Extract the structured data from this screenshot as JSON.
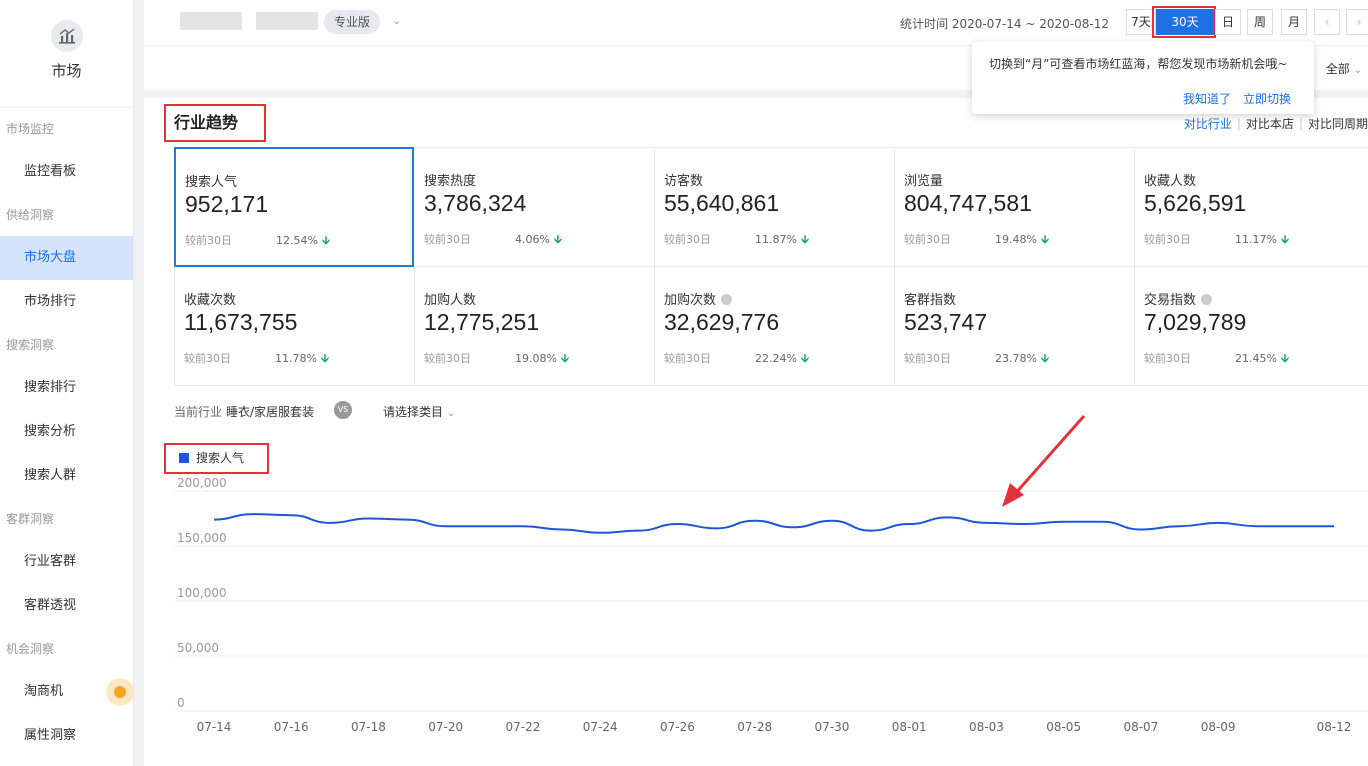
{
  "sidebar": {
    "logo_label": "市场",
    "groups": [
      {
        "label": "市场监控",
        "items": [
          "监控看板"
        ]
      },
      {
        "label": "供给洞察",
        "items": [
          "市场大盘",
          "市场排行"
        ]
      },
      {
        "label": "搜索洞察",
        "items": [
          "搜索排行",
          "搜索分析",
          "搜索人群"
        ]
      },
      {
        "label": "客群洞察",
        "items": [
          "行业客群",
          "客群透视"
        ]
      },
      {
        "label": "机会洞察",
        "items": [
          "淘商机",
          "属性洞察"
        ]
      }
    ],
    "active_item": "市场大盘"
  },
  "topbar": {
    "edition_badge": "专业版",
    "stat_time": "统计时间 2020-07-14 ~ 2020-08-12",
    "range_buttons": [
      "7天",
      "30天",
      "日",
      "周",
      "月"
    ],
    "active_range": "30天",
    "prev_icon": "chevron-left-icon",
    "next_icon": "chevron-right-icon"
  },
  "subbar": {
    "all_label": "全部"
  },
  "tooltip": {
    "text": "切换到“月”可查看市场红蓝海，帮您发现市场新机会哦~",
    "ack_link": "我知道了",
    "switch_link": "立即切换"
  },
  "trend": {
    "title": "行业趋势",
    "compare_industry": "对比行业",
    "compare_store": "对比本店",
    "compare_period": "对比同周期"
  },
  "metrics": [
    {
      "title": "搜索人气",
      "value": "952,171",
      "compare_label": "较前30日",
      "change": "12.54%",
      "info": false
    },
    {
      "title": "搜索热度",
      "value": "3,786,324",
      "compare_label": "较前30日",
      "change": "4.06%",
      "info": false
    },
    {
      "title": "访客数",
      "value": "55,640,861",
      "compare_label": "较前30日",
      "change": "11.87%",
      "info": false
    },
    {
      "title": "浏览量",
      "value": "804,747,581",
      "compare_label": "较前30日",
      "change": "19.48%",
      "info": false
    },
    {
      "title": "收藏人数",
      "value": "5,626,591",
      "compare_label": "较前30日",
      "change": "11.17%",
      "info": false
    },
    {
      "title": "收藏次数",
      "value": "11,673,755",
      "compare_label": "较前30日",
      "change": "11.78%",
      "info": false
    },
    {
      "title": "加购人数",
      "value": "12,775,251",
      "compare_label": "较前30日",
      "change": "19.08%",
      "info": false
    },
    {
      "title": "加购次数",
      "value": "32,629,776",
      "compare_label": "较前30日",
      "change": "22.24%",
      "info": true
    },
    {
      "title": "客群指数",
      "value": "523,747",
      "compare_label": "较前30日",
      "change": "23.78%",
      "info": false
    },
    {
      "title": "交易指数",
      "value": "7,029,789",
      "compare_label": "较前30日",
      "change": "21.45%",
      "info": true
    }
  ],
  "filter": {
    "current_industry_label": "当前行业",
    "current_industry": "睡衣/家居服套装",
    "vs_label": "VS",
    "select_placeholder": "请选择类目"
  },
  "colors": {
    "accent": "#1f6fe5",
    "series": "#1f55d8",
    "down_arrow": "#12a452",
    "highlight_box": "#e0333b"
  },
  "chart_data": {
    "type": "line",
    "legend": [
      "搜索人气"
    ],
    "ylim": [
      0,
      200000
    ],
    "yticks": [
      "200,000",
      "150,000",
      "100,000",
      "50,000",
      "0"
    ],
    "ytick_values": [
      200000,
      150000,
      100000,
      50000,
      0
    ],
    "x_labels": [
      "07-14",
      "07-16",
      "07-18",
      "07-20",
      "07-22",
      "07-24",
      "07-26",
      "07-28",
      "07-30",
      "08-01",
      "08-03",
      "08-05",
      "08-07",
      "08-09",
      "08-12"
    ],
    "x": [
      "07-14",
      "07-15",
      "07-16",
      "07-17",
      "07-18",
      "07-19",
      "07-20",
      "07-21",
      "07-22",
      "07-23",
      "07-24",
      "07-25",
      "07-26",
      "07-27",
      "07-28",
      "07-29",
      "07-30",
      "07-31",
      "08-01",
      "08-02",
      "08-03",
      "08-04",
      "08-05",
      "08-06",
      "08-07",
      "08-08",
      "08-09",
      "08-10",
      "08-11",
      "08-12"
    ],
    "series": [
      {
        "name": "搜索人气",
        "values": [
          174000,
          179000,
          178000,
          171000,
          175000,
          174000,
          168000,
          168000,
          168000,
          165000,
          162000,
          164000,
          170000,
          166000,
          173000,
          167000,
          173000,
          164000,
          170000,
          176000,
          171000,
          170000,
          172000,
          172000,
          165000,
          168000,
          171000,
          168000,
          168000,
          168000
        ]
      }
    ],
    "grid": "horizontal",
    "annotation": "red arrow pointing to line near 08-02"
  }
}
